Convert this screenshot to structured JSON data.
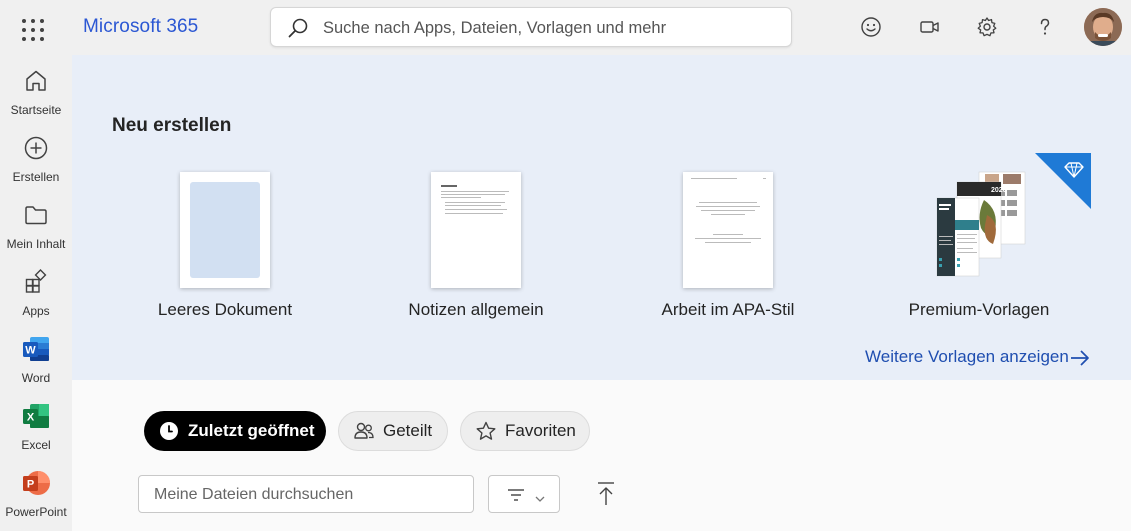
{
  "header": {
    "brand": "Microsoft 365",
    "search_placeholder": "Suche nach Apps, Dateien, Vorlagen und mehr",
    "icons": [
      "waffle-icon",
      "smiley-icon",
      "video-icon",
      "gear-icon",
      "help-icon"
    ]
  },
  "sidebar": {
    "items": [
      {
        "label": "Startseite",
        "icon": "home-icon"
      },
      {
        "label": "Erstellen",
        "icon": "plus-circle-icon"
      },
      {
        "label": "Mein Inhalt",
        "icon": "folder-icon"
      },
      {
        "label": "Apps",
        "icon": "apps-icon"
      },
      {
        "label": "Word",
        "icon": "word-icon"
      },
      {
        "label": "Excel",
        "icon": "excel-icon"
      },
      {
        "label": "PowerPoint",
        "icon": "powerpoint-icon"
      }
    ]
  },
  "hero": {
    "title": "Neu erstellen",
    "templates": [
      {
        "name": "Leeres Dokument"
      },
      {
        "name": "Notizen allgemein"
      },
      {
        "name": "Arbeit im APA-Stil"
      },
      {
        "name": "Premium-Vorlagen"
      }
    ],
    "more_link": "Weitere Vorlagen anzeigen",
    "premium_year": "2020"
  },
  "files": {
    "tabs": [
      {
        "label": "Zuletzt geöffnet",
        "icon": "clock-icon",
        "active": true
      },
      {
        "label": "Geteilt",
        "icon": "people-icon",
        "active": false
      },
      {
        "label": "Favoriten",
        "icon": "star-icon",
        "active": false
      }
    ],
    "search_placeholder": "Meine Dateien durchsuchen"
  },
  "colors": {
    "brand": "#2b57d3",
    "hero_bg": "#e8eef8",
    "link": "#1f4eb0",
    "word": "#185abd",
    "excel": "#107c41",
    "powerpoint": "#c43e1c",
    "premium": "#1f7ad6"
  }
}
